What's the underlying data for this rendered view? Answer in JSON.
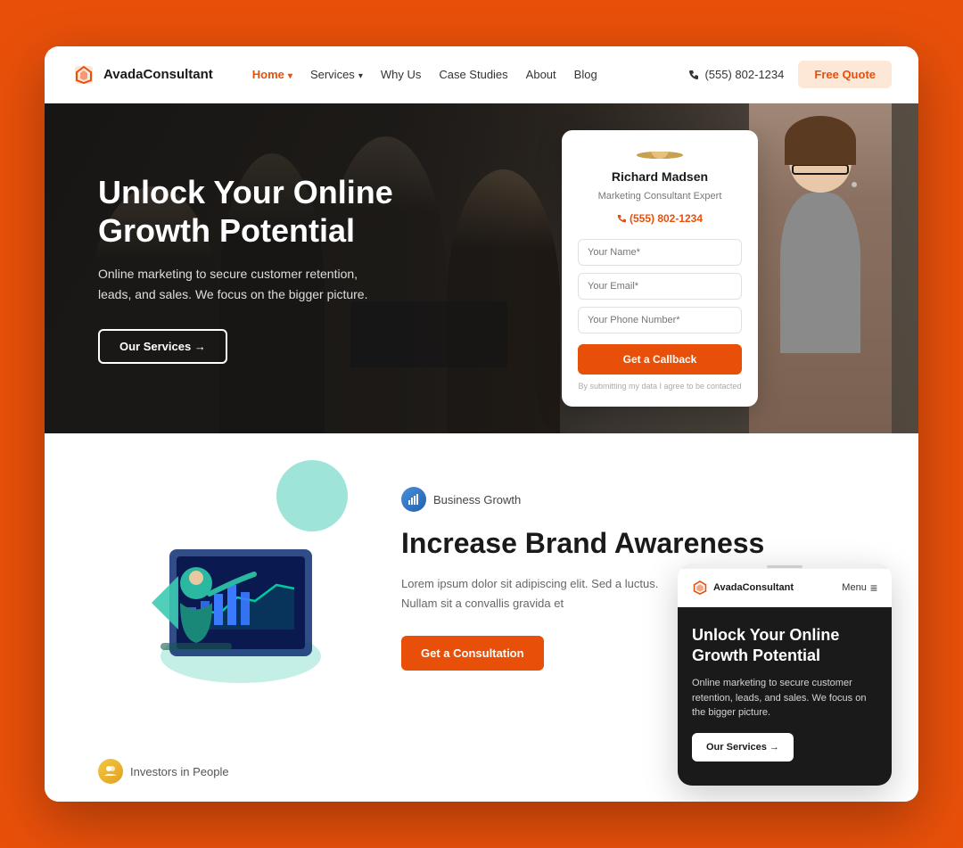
{
  "outer_bg": "#E8500A",
  "brand": {
    "name": "AvadaConsultant",
    "logo_symbol": "◈"
  },
  "navbar": {
    "links": [
      {
        "label": "Home",
        "active": true,
        "has_dropdown": true
      },
      {
        "label": "Services",
        "active": false,
        "has_dropdown": true
      },
      {
        "label": "Why Us",
        "active": false,
        "has_dropdown": false
      },
      {
        "label": "Case Studies",
        "active": false,
        "has_dropdown": false
      },
      {
        "label": "About",
        "active": false,
        "has_dropdown": false
      },
      {
        "label": "Blog",
        "active": false,
        "has_dropdown": false
      }
    ],
    "phone": "(555) 802-1234",
    "cta_label": "Free Quote"
  },
  "hero": {
    "title": "Unlock Your Online Growth Potential",
    "subtitle": "Online marketing to secure customer retention, leads, and sales. We focus on the bigger picture.",
    "cta_label": "Our Services →"
  },
  "contact_card": {
    "consultant_name": "Richard Madsen",
    "consultant_title": "Marketing Consultant Expert",
    "phone": "(555) 802-1234",
    "name_placeholder": "Your Name*",
    "email_placeholder": "Your Email*",
    "phone_placeholder": "Your Phone Number*",
    "cta_label": "Get a Callback",
    "disclaimer": "By submitting my data I agree to be contacted"
  },
  "content_section": {
    "badge_label": "Business Growth",
    "section_title": "Increase Brand Awareness",
    "body_text": "Lorem ipsum dolor sit adipiscing elit. Sed a luctus. Nullam sit a convallis gravida et",
    "cta_label": "Get a Consultation"
  },
  "mobile_preview": {
    "logo_text": "AvadaConsultant",
    "menu_label": "Menu",
    "hero_title": "Unlock Your Online Growth Potential",
    "hero_subtitle": "Online marketing to secure customer retention, leads, and sales. We focus on the bigger picture.",
    "cta_label": "Our Services →"
  },
  "bottom_section": {
    "badge_label": "Investors in People"
  },
  "colors": {
    "accent": "#E8500A",
    "white": "#ffffff",
    "dark": "#1a1a1a",
    "teal": "#3dcab1",
    "blue": "#2060b0",
    "yellow": "#f5c842"
  }
}
